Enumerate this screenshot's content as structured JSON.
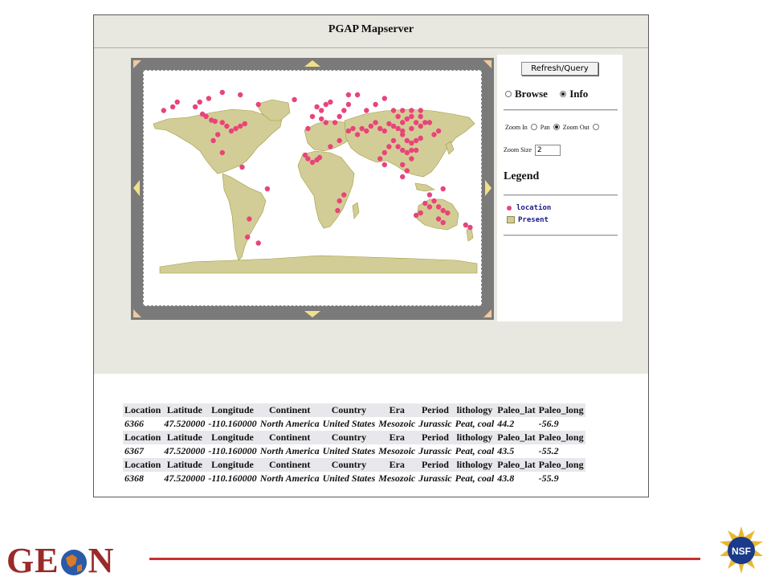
{
  "app": {
    "title": "PGAP Mapserver"
  },
  "controls": {
    "refresh_label": "Refresh/Query",
    "mode_options": [
      {
        "label": "Browse",
        "selected": false
      },
      {
        "label": "Info",
        "selected": true
      }
    ],
    "zoom_options": [
      {
        "label": "Zoom In",
        "selected": false
      },
      {
        "label": "Pan",
        "selected": true
      },
      {
        "label": "Zoom Out",
        "selected": false
      }
    ],
    "zoom_size_label": "Zoom Size",
    "zoom_size_value": "2",
    "legend_title": "Legend",
    "legend_items": [
      {
        "label": "location",
        "color": "#e8447a"
      },
      {
        "label": "Present",
        "color": "#d2cd96"
      }
    ]
  },
  "map": {
    "land_color": "#d2cd96",
    "border_color": "#a09a40",
    "point_color": "#e8447a",
    "points": [
      [
        -130,
        58
      ],
      [
        -122,
        52
      ],
      [
        -118,
        50
      ],
      [
        -112,
        47
      ],
      [
        -108,
        46
      ],
      [
        -100,
        45
      ],
      [
        -95,
        42
      ],
      [
        -90,
        38
      ],
      [
        -85,
        40
      ],
      [
        -80,
        42
      ],
      [
        -75,
        44
      ],
      [
        -125,
        62
      ],
      [
        -115,
        65
      ],
      [
        -100,
        70
      ],
      [
        -80,
        68
      ],
      [
        -60,
        60
      ],
      [
        -150,
        62
      ],
      [
        -155,
        58
      ],
      [
        -165,
        55
      ],
      [
        -105,
        35
      ],
      [
        -110,
        30
      ],
      [
        -100,
        20
      ],
      [
        -78,
        8
      ],
      [
        -50,
        -10
      ],
      [
        -70,
        -35
      ],
      [
        -72,
        -50
      ],
      [
        -60,
        -55
      ],
      [
        -20,
        64
      ],
      [
        5,
        58
      ],
      [
        10,
        55
      ],
      [
        15,
        60
      ],
      [
        20,
        62
      ],
      [
        0,
        50
      ],
      [
        10,
        48
      ],
      [
        15,
        45
      ],
      [
        25,
        45
      ],
      [
        30,
        50
      ],
      [
        35,
        55
      ],
      [
        40,
        60
      ],
      [
        -5,
        40
      ],
      [
        -8,
        18
      ],
      [
        -5,
        15
      ],
      [
        0,
        12
      ],
      [
        5,
        14
      ],
      [
        8,
        16
      ],
      [
        20,
        25
      ],
      [
        30,
        30
      ],
      [
        40,
        38
      ],
      [
        45,
        40
      ],
      [
        50,
        35
      ],
      [
        55,
        40
      ],
      [
        60,
        38
      ],
      [
        65,
        42
      ],
      [
        70,
        45
      ],
      [
        75,
        40
      ],
      [
        80,
        38
      ],
      [
        85,
        44
      ],
      [
        90,
        42
      ],
      [
        95,
        40
      ],
      [
        100,
        38
      ],
      [
        100,
        35
      ],
      [
        105,
        30
      ],
      [
        110,
        28
      ],
      [
        115,
        30
      ],
      [
        120,
        32
      ],
      [
        110,
        40
      ],
      [
        115,
        45
      ],
      [
        120,
        42
      ],
      [
        125,
        45
      ],
      [
        100,
        45
      ],
      [
        105,
        48
      ],
      [
        110,
        50
      ],
      [
        120,
        50
      ],
      [
        130,
        45
      ],
      [
        90,
        30
      ],
      [
        95,
        25
      ],
      [
        100,
        22
      ],
      [
        105,
        20
      ],
      [
        110,
        22
      ],
      [
        115,
        22
      ],
      [
        85,
        25
      ],
      [
        80,
        20
      ],
      [
        75,
        15
      ],
      [
        100,
        10
      ],
      [
        105,
        5
      ],
      [
        100,
        0
      ],
      [
        110,
        15
      ],
      [
        95,
        50
      ],
      [
        90,
        55
      ],
      [
        100,
        55
      ],
      [
        110,
        55
      ],
      [
        120,
        55
      ],
      [
        60,
        55
      ],
      [
        70,
        60
      ],
      [
        80,
        65
      ],
      [
        50,
        68
      ],
      [
        40,
        68
      ],
      [
        135,
        -20
      ],
      [
        140,
        -25
      ],
      [
        145,
        -28
      ],
      [
        150,
        -30
      ],
      [
        130,
        -25
      ],
      [
        120,
        -30
      ],
      [
        125,
        -22
      ],
      [
        115,
        -32
      ],
      [
        140,
        -35
      ],
      [
        145,
        -38
      ],
      [
        170,
        -40
      ],
      [
        175,
        -42
      ],
      [
        30,
        -20
      ],
      [
        35,
        -15
      ],
      [
        28,
        -28
      ],
      [
        145,
        -10
      ],
      [
        130,
        -15
      ],
      [
        80,
        10
      ],
      [
        135,
        35
      ],
      [
        140,
        38
      ]
    ]
  },
  "results": {
    "headers": [
      "Location",
      "Latitude",
      "Longitude",
      "Continent",
      "Country",
      "Era",
      "Period",
      "lithology",
      "Paleo_lat",
      "Paleo_long"
    ],
    "rows": [
      [
        "6366",
        "47.520000",
        "-110.160000",
        "North America",
        "United States",
        "Mesozoic",
        "Jurassic",
        "Peat, coal",
        "44.2",
        "-56.9"
      ],
      [
        "6367",
        "47.520000",
        "-110.160000",
        "North America",
        "United States",
        "Mesozoic",
        "Jurassic",
        "Peat, coal",
        "43.5",
        "-55.2"
      ],
      [
        "6368",
        "47.520000",
        "-110.160000",
        "North America",
        "United States",
        "Mesozoic",
        "Jurassic",
        "Peat, coal",
        "43.8",
        "-55.9"
      ]
    ]
  },
  "footer": {
    "geon_text": [
      "GE",
      "N"
    ],
    "line_color": "#c83030",
    "nsf_text": "NSF"
  }
}
